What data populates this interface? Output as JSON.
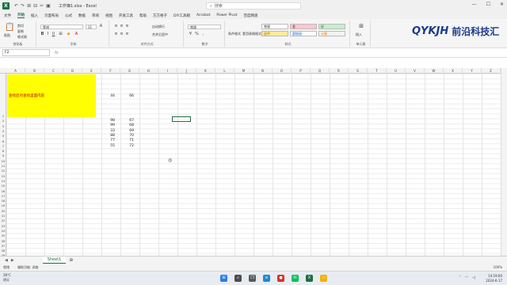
{
  "title_bar": {
    "doc_title": "工作簿1.xlsx - Excel",
    "search_placeholder": "搜索",
    "qat": [
      "↶",
      "↷",
      "⊞",
      "⊟",
      "✂",
      "▣"
    ]
  },
  "menu": [
    "文件",
    "开始",
    "插入",
    "页面布局",
    "公式",
    "数据",
    "审阅",
    "视图",
    "开发工具",
    "帮助",
    "方方格子",
    "DIY工具箱",
    "Acrobat",
    "Power Pivot",
    "百度网盘"
  ],
  "ribbon": {
    "groups": [
      "剪贴板",
      "字体",
      "对齐方式",
      "数字",
      "样式",
      "单元格"
    ],
    "clipboard": {
      "paste": "粘贴",
      "cut": "剪切",
      "copy": "复制",
      "format_painter": "格式刷"
    },
    "font": {
      "name": "等线",
      "size": "11"
    },
    "align": {
      "wrap": "自动换行",
      "merge": "合并后居中"
    },
    "number": {
      "format": "常规"
    },
    "styles": {
      "conditional": "条件格式",
      "table": "套用表格格式",
      "cells": [
        {
          "label": "常规",
          "bg": "#ffffff",
          "fg": "#222222"
        },
        {
          "label": "差",
          "bg": "#ffc7ce",
          "fg": "#9c0006"
        },
        {
          "label": "好",
          "bg": "#c6efce",
          "fg": "#006100"
        },
        {
          "label": "适中",
          "bg": "#ffeb9c",
          "fg": "#9c5700"
        },
        {
          "label": "超链接",
          "bg": "#ffffff",
          "fg": "#0563c1"
        },
        {
          "label": "计算",
          "bg": "#f2f2f2",
          "fg": "#fa7d00"
        }
      ]
    },
    "cells_group": {
      "insert": "插入"
    }
  },
  "logo": {
    "latin": "QYKJH",
    "cjk": "前沿科技汇"
  },
  "formula_bar": {
    "name_box": "F2",
    "fx": "fx"
  },
  "grid": {
    "columns": [
      "A",
      "B",
      "C",
      "D",
      "E",
      "F",
      "G",
      "H",
      "I",
      "J",
      "K",
      "L",
      "M",
      "N",
      "O",
      "P",
      "Q",
      "R",
      "S",
      "T",
      "U",
      "V",
      "W",
      "X",
      "Y",
      "Z"
    ],
    "yellow_cell_text": "查找后对查找里面内容",
    "row1_values": [
      "44",
      "66"
    ],
    "data_pairs": [
      [
        "98",
        "67"
      ],
      [
        "99",
        "68"
      ],
      [
        "33",
        "69"
      ],
      [
        "88",
        "70"
      ],
      [
        "77",
        "71"
      ],
      [
        "55",
        "72"
      ]
    ],
    "row_labels": [
      "1",
      "2",
      "3",
      "4",
      "5",
      "6",
      "7",
      "8",
      "9",
      "10",
      "11",
      "12",
      "13",
      "14",
      "15",
      "16",
      "17",
      "18",
      "19",
      "20",
      "21",
      "22",
      "23",
      "24",
      "25",
      "26",
      "27",
      "28",
      "29",
      "30",
      "31"
    ]
  },
  "sheet": {
    "tab": "Sheet1",
    "add": "⊕"
  },
  "status": {
    "ready": "就绪",
    "accessibility": "辅助功能: 调查",
    "zoom": "100%"
  },
  "taskbar": {
    "weather_temp": "28°C",
    "weather_desc": "阴天",
    "time": "14:19:00",
    "date": "2024-6-17",
    "apps": [
      {
        "icon": "start-icon",
        "color": "#2b7de9"
      },
      {
        "icon": "search-icon",
        "color": "#4c4c4c"
      },
      {
        "icon": "task-view-icon",
        "color": "#5a5a5a"
      },
      {
        "icon": "edge-icon",
        "color": "#1a8ad4"
      },
      {
        "icon": "chrome-icon",
        "color": "#d93025"
      },
      {
        "icon": "wechat-icon",
        "color": "#07c160"
      },
      {
        "icon": "excel-icon",
        "color": "#1d6f42"
      },
      {
        "icon": "explorer-icon",
        "color": "#f2b200"
      }
    ]
  }
}
